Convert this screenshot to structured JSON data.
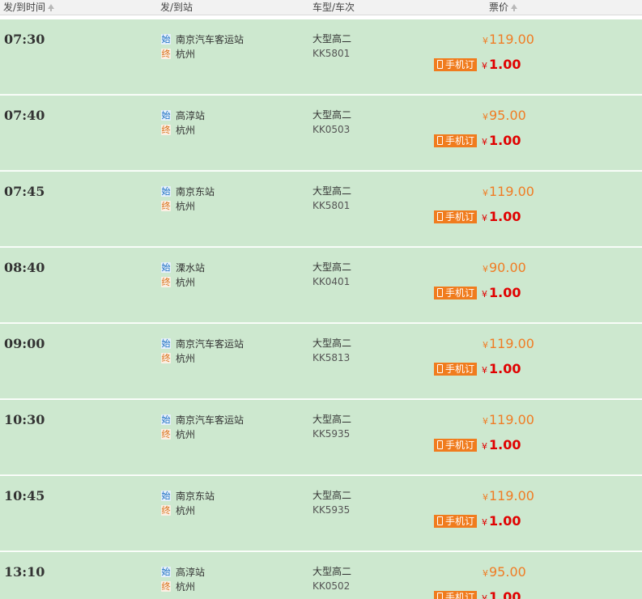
{
  "header": {
    "time_label": "发/到时间",
    "station_label": "发/到站",
    "bus_label": "车型/车次",
    "price_label": "票价"
  },
  "icons": {
    "start": "始",
    "end": "终",
    "yen": "¥"
  },
  "mobile_label": "手机订",
  "colors": {
    "row_bg": "#cde8cf",
    "price": "#f07c24",
    "mobile_badge": "#f07c1e",
    "mobile_price": "#e00000"
  },
  "rows": [
    {
      "time": "07:30",
      "from": "南京汽车客运站",
      "to": "杭州",
      "bus_type": "大型高二",
      "code": "KK5801",
      "price": "119.00",
      "mobile_price": "1.00"
    },
    {
      "time": "07:40",
      "from": "高淳站",
      "to": "杭州",
      "bus_type": "大型高二",
      "code": "KK0503",
      "price": "95.00",
      "mobile_price": "1.00"
    },
    {
      "time": "07:45",
      "from": "南京东站",
      "to": "杭州",
      "bus_type": "大型高二",
      "code": "KK5801",
      "price": "119.00",
      "mobile_price": "1.00"
    },
    {
      "time": "08:40",
      "from": "溧水站",
      "to": "杭州",
      "bus_type": "大型高二",
      "code": "KK0401",
      "price": "90.00",
      "mobile_price": "1.00"
    },
    {
      "time": "09:00",
      "from": "南京汽车客运站",
      "to": "杭州",
      "bus_type": "大型高二",
      "code": "KK5813",
      "price": "119.00",
      "mobile_price": "1.00"
    },
    {
      "time": "10:30",
      "from": "南京汽车客运站",
      "to": "杭州",
      "bus_type": "大型高二",
      "code": "KK5935",
      "price": "119.00",
      "mobile_price": "1.00"
    },
    {
      "time": "10:45",
      "from": "南京东站",
      "to": "杭州",
      "bus_type": "大型高二",
      "code": "KK5935",
      "price": "119.00",
      "mobile_price": "1.00"
    },
    {
      "time": "13:10",
      "from": "高淳站",
      "to": "杭州",
      "bus_type": "大型高二",
      "code": "KK0502",
      "price": "95.00",
      "mobile_price": "1.00"
    }
  ]
}
